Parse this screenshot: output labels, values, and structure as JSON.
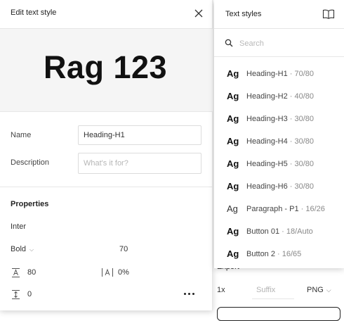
{
  "edit_panel": {
    "title": "Edit text style",
    "preview_text": "Rag 123",
    "name_label": "Name",
    "name_value": "Heading-H1",
    "description_label": "Description",
    "description_placeholder": "What's it for?",
    "properties_title": "Properties",
    "font_family": "Inter",
    "font_weight": "Bold",
    "font_size": "70",
    "line_height": "80",
    "letter_spacing": "0%",
    "paragraph_spacing": "0",
    "icons": [
      "close-icon",
      "line-height-icon",
      "letter-spacing-icon",
      "paragraph-spacing-icon",
      "more-icon",
      "chevron-down-icon"
    ]
  },
  "styles_panel": {
    "title": "Text styles",
    "search_placeholder": "Search",
    "items": [
      {
        "glyph": "Ag",
        "name": "Heading-H1",
        "meta": " · 70/80",
        "weight": "bold"
      },
      {
        "glyph": "Ag",
        "name": "Heading-H2",
        "meta": " · 40/80",
        "weight": "bold"
      },
      {
        "glyph": "Ag",
        "name": "Heading-H3",
        "meta": " · 30/80",
        "weight": "bold"
      },
      {
        "glyph": "Ag",
        "name": "Heading-H4",
        "meta": " · 30/80",
        "weight": "bold"
      },
      {
        "glyph": "Ag",
        "name": "Heading-H5",
        "meta": " · 30/80",
        "weight": "bold"
      },
      {
        "glyph": "Ag",
        "name": "Heading-H6",
        "meta": " · 30/80",
        "weight": "bold"
      },
      {
        "glyph": "Ag",
        "name": "Paragraph - P1",
        "meta": " · 16/26",
        "weight": "regular"
      },
      {
        "glyph": "Ag",
        "name": "Button 01",
        "meta": " · 18/Auto",
        "weight": "bold"
      },
      {
        "glyph": "Ag",
        "name": "Button 2",
        "meta": " · 16/65",
        "weight": "bold"
      }
    ],
    "icons": [
      "library-icon",
      "search-icon"
    ]
  },
  "background": {
    "export_label": "Export",
    "scale": "1x",
    "suffix_placeholder": "Suffix",
    "format": "PNG"
  }
}
